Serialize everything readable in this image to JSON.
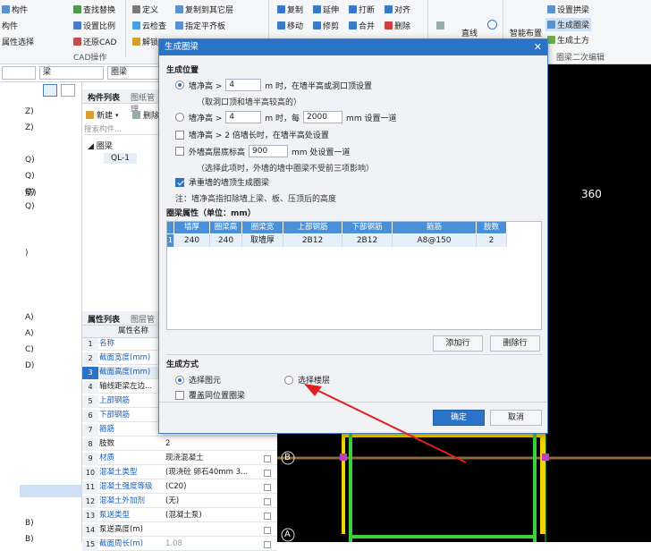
{
  "ribbon": {
    "items": [
      "构件",
      "查找替换",
      "设置比例",
      "还原CAD",
      "CAD操作",
      "定义",
      "云检查",
      "解锁",
      "复制到其它层",
      "指定平齐板",
      "移动",
      "修剪",
      "复制",
      "延伸",
      "打断",
      "合并",
      "删除",
      "对齐",
      "直线",
      "智能布置",
      "设置拱梁",
      "生成圈梁",
      "生成土方",
      "圈梁二次编辑",
      "属性选择"
    ]
  },
  "filter": {
    "type": "梁",
    "name": "圈梁"
  },
  "left_tree": {
    "items": [
      "Z)",
      "Z)",
      "Q)",
      "Q)",
      "Q)",
      "筋)",
      "Q)",
      ")",
      "A)",
      "A)",
      "C)",
      "D)",
      "B)",
      "B)"
    ]
  },
  "component_panel": {
    "tabs": [
      "构件列表",
      "图纸管理"
    ],
    "new_label": "新建",
    "delete_label": "删除",
    "search_placeholder": "搜索构件...",
    "tree_root": "圈梁",
    "tree_child": "QL-1"
  },
  "property_panel": {
    "tabs": [
      "属性列表",
      "图层管理"
    ],
    "header": "属性名称",
    "rows": [
      {
        "n": "1",
        "name": "名称",
        "val": ""
      },
      {
        "n": "2",
        "name": "截面宽度(mm)",
        "val": ""
      },
      {
        "n": "3",
        "name": "截面高度(mm)",
        "val": ""
      },
      {
        "n": "4",
        "name": "轴线距梁左边...",
        "val": ""
      },
      {
        "n": "5",
        "name": "上部钢筋",
        "val": ""
      },
      {
        "n": "6",
        "name": "下部钢筋",
        "val": ""
      },
      {
        "n": "7",
        "name": "箍筋",
        "val": ""
      },
      {
        "n": "8",
        "name": "肢数",
        "val": "2"
      },
      {
        "n": "9",
        "name": "材质",
        "val": "现浇混凝土"
      },
      {
        "n": "10",
        "name": "混凝土类型",
        "val": "(现浇砼 卵石40mm 3..."
      },
      {
        "n": "11",
        "name": "混凝土强度等级",
        "val": "(C20)"
      },
      {
        "n": "12",
        "name": "混凝土外加剂",
        "val": "(无)"
      },
      {
        "n": "13",
        "name": "泵送类型",
        "val": "(混凝土泵)"
      },
      {
        "n": "14",
        "name": "泵送高度(m)",
        "val": ""
      },
      {
        "n": "15",
        "name": "截面周长(m)",
        "val": "1.08"
      }
    ]
  },
  "canvas": {
    "dim_text": "360",
    "axis_b": "B",
    "axis_a": "A"
  },
  "dialog": {
    "title": "生成圈梁",
    "section_position": "生成位置",
    "opt1_prefix": "墙净高 >",
    "opt1_value": "4",
    "opt1_suffix": "m 时，在墙半高或洞口顶设置",
    "opt1_note": "（取洞口顶和墙半高较高的）",
    "opt2_prefix": "墙净高 >",
    "opt2_value": "4",
    "opt2_mid": "m 时，每",
    "opt2_value2": "2000",
    "opt2_suffix": "mm 设置一道",
    "opt3": "墙净高 > 2 倍墙长时，在墙半高处设置",
    "opt4_prefix": "外墙高层底标高",
    "opt4_value": "900",
    "opt4_suffix": "mm 处设置一道",
    "opt4_note": "（选择此项时，外墙的墙中圈梁不受前三项影响）",
    "opt5": "承重墙的墙顶生成圈梁",
    "note": "注：墙净高指扣除墙上梁、板、压顶后的高度",
    "grid_title": "圈梁属性（单位：mm）",
    "grid_headers": [
      "墙厚",
      "圈梁高",
      "圈梁宽",
      "上部钢筋",
      "下部钢筋",
      "箍筋",
      "肢数"
    ],
    "grid_row_index": "1",
    "grid_row": [
      "240",
      "240",
      "取墙厚",
      "2B12",
      "2B12",
      "A8@150",
      "2"
    ],
    "add_row": "添加行",
    "delete_row": "删除行",
    "section_method": "生成方式",
    "method_select": "选择图元",
    "method_floor": "选择楼层",
    "overwrite": "覆盖同位置圈梁",
    "ok": "确定",
    "cancel": "取消"
  },
  "colors": {
    "accent": "#2b73c6",
    "canvas": "#000000",
    "wall": "#f5d300",
    "wall_green": "#3ad13a",
    "arrow": "#e02020"
  }
}
